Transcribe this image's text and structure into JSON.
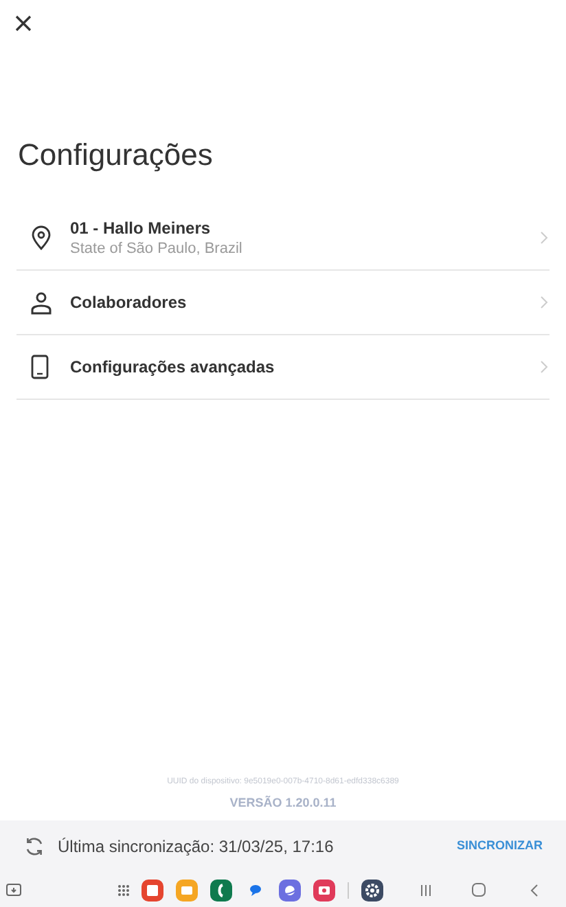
{
  "title": "Configurações",
  "items": [
    {
      "kind": "location",
      "label": "01 - Hallo Meiners",
      "subtitle": "State of São Paulo, Brazil"
    },
    {
      "kind": "person",
      "label": "Colaboradores"
    },
    {
      "kind": "device",
      "label": "Configurações avançadas"
    }
  ],
  "device_uuid": "UUID do dispositivo: 9e5019e0-007b-4710-8d61-edfd338c6389",
  "version": "VERSÃO 1.20.0.11",
  "sync_bar": {
    "last_sync": "Última sincronização: 31/03/25, 17:16",
    "action": "SINCRONIZAR"
  },
  "taskbar": {
    "apps": [
      {
        "kind": "note",
        "color": "#e5452f"
      },
      {
        "kind": "folder",
        "color": "#f5a623"
      },
      {
        "kind": "phone",
        "color": "#0f7a4e"
      },
      {
        "kind": "chat",
        "color": "#1a73e8"
      },
      {
        "kind": "planet",
        "color": "#6c6fe0"
      },
      {
        "kind": "camera",
        "color": "#e03a5a"
      },
      {
        "kind": "settings",
        "color": "#3c4a63"
      }
    ]
  }
}
